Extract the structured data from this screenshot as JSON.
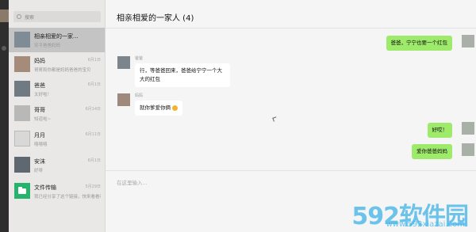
{
  "search": {
    "placeholder": "搜索"
  },
  "sessions": [
    {
      "name": "相亲相爱的一家...",
      "time": "",
      "preview": "安平爸爸妈妈",
      "active": true
    },
    {
      "name": "妈妈",
      "time": "6月1日",
      "preview": "哥哥和你都是妈妈爸爸的宝贝",
      "active": false
    },
    {
      "name": "爸爸",
      "time": "6月1日",
      "preview": "太好啦！",
      "active": false
    },
    {
      "name": "哥哥",
      "time": "6月14日",
      "preview": "知道啦~",
      "active": false
    },
    {
      "name": "月月",
      "time": "6月11日",
      "preview": "嘻嘻嘻",
      "active": false
    },
    {
      "name": "安沫",
      "time": "6月1日",
      "preview": "好呀",
      "active": false
    },
    {
      "name": "文件传输",
      "time": "5月29日",
      "preview": "我已经分享了这个链接，快来看看吧",
      "active": false
    }
  ],
  "chat": {
    "title": "相亲相爱的一家人 (4)",
    "messages": [
      {
        "from": "me",
        "text": "爸爸，宁宁也要一个红包"
      },
      {
        "from": "other",
        "sender": "爸爸",
        "text": "行，等爸爸回来，爸爸给宁宁一个大大的红包"
      },
      {
        "from": "other",
        "sender": "妈妈",
        "text": "就你爹爱你俩"
      },
      {
        "from": "me",
        "text": "好哎！"
      },
      {
        "from": "me",
        "text": "爱你爸爸妈妈"
      }
    ],
    "input_placeholder": "在这里输入..."
  },
  "watermark": {
    "brand": "592软件园",
    "url": "www.592xiazai.com"
  },
  "colors": {
    "bubble_me": "#9eea6a",
    "bubble_other": "#ffffff",
    "watermark": "#3db3e8"
  },
  "icons": [
    "search-icon",
    "file-transfer-icon",
    "smile-emoji-icon"
  ]
}
